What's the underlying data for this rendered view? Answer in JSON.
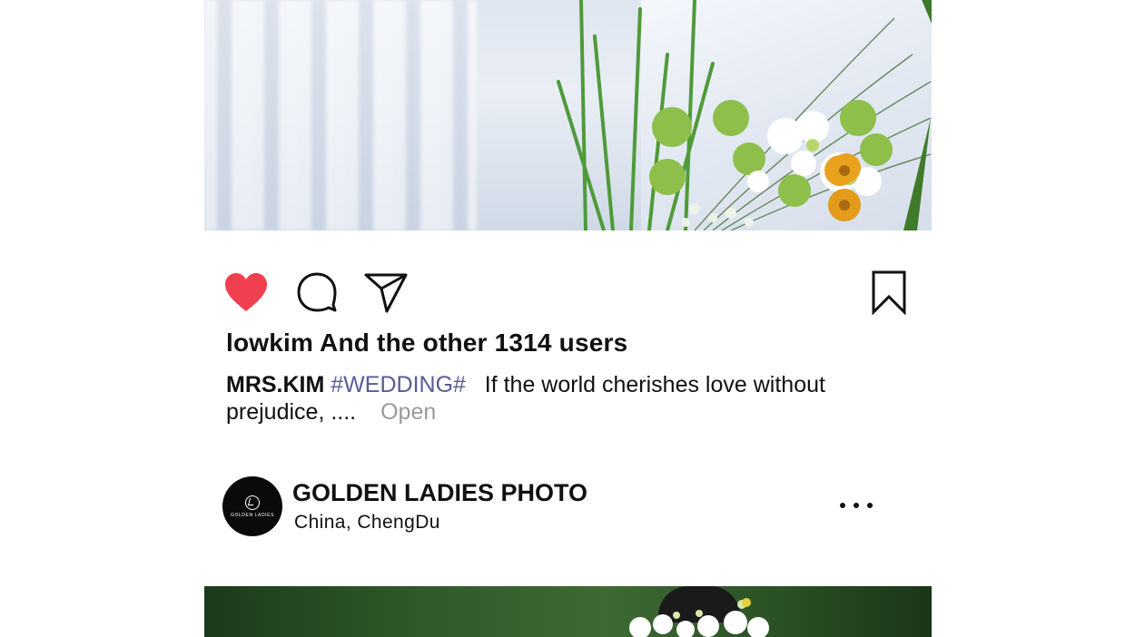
{
  "post": {
    "likes_text": "lowkim And the other 1314 users",
    "caption": {
      "author": "MRS.KIM",
      "hashtag": "#WEDDING#",
      "text": "If the world cherishes love without prejudice, ....",
      "open_label": "Open"
    },
    "actions": {
      "like_icon": "heart-icon",
      "comment_icon": "comment-bubble-icon",
      "share_icon": "send-icon",
      "bookmark_icon": "bookmark-icon",
      "like_color": "#f0404f"
    }
  },
  "profile": {
    "name": "GOLDEN LADIES PHOTO",
    "location": "China,  ChengDu",
    "avatar_text": "GOLDEN LADIES",
    "more_icon": "more-dots-icon"
  }
}
